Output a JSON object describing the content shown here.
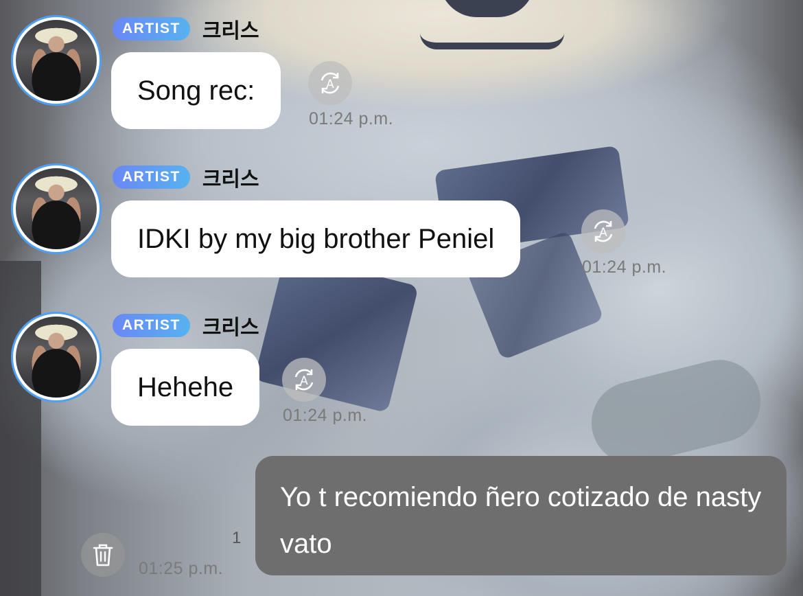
{
  "messages": [
    {
      "badge": "ARTIST",
      "sender": "크리스",
      "text": "Song rec:",
      "time": "01:24 p.m."
    },
    {
      "badge": "ARTIST",
      "sender": "크리스",
      "text": "IDKI by my big brother Peniel",
      "time": "01:24 p.m."
    },
    {
      "badge": "ARTIST",
      "sender": "크리스",
      "text": "Hehehe",
      "time": "01:24 p.m."
    }
  ],
  "my_message": {
    "text": "Yo t recomiendo ñero cotizado de nasty vato",
    "time": "01:25 p.m.",
    "unread_count": "1"
  },
  "icons": {
    "translate": "translate-icon",
    "delete": "trash-icon"
  },
  "colors": {
    "badge_start": "#6a87f5",
    "badge_end": "#57b2f0",
    "avatar_ring": "#4f9ff2",
    "my_bubble": "#6e6e6e"
  }
}
